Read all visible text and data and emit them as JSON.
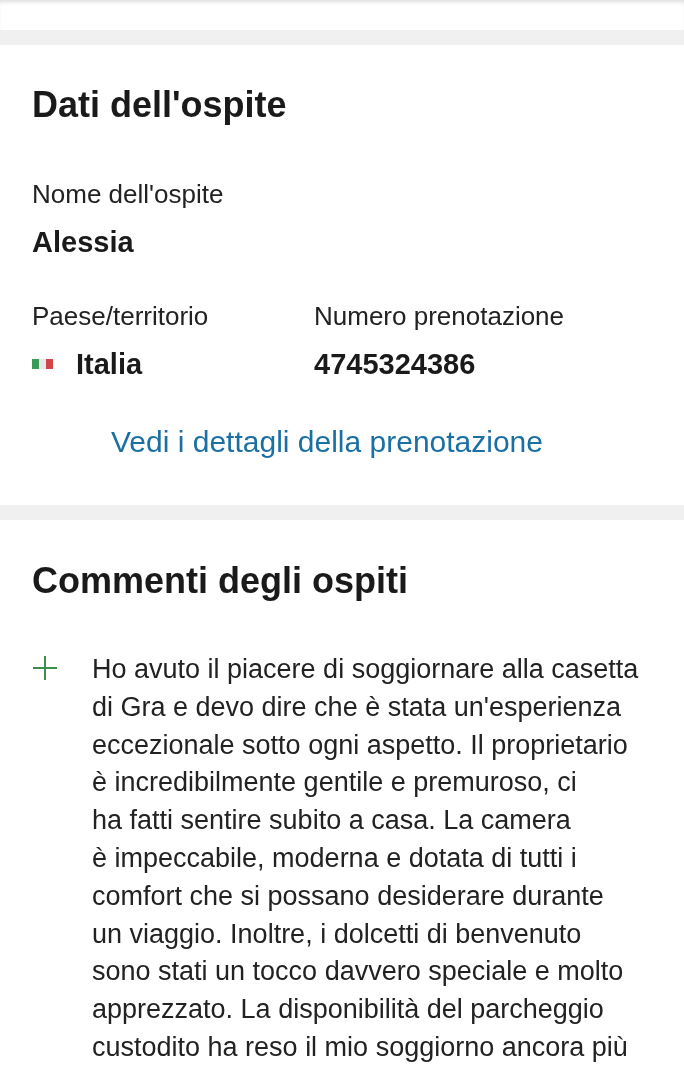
{
  "guest_section": {
    "title": "Dati dell'ospite",
    "name_label": "Nome dell'ospite",
    "name_value": "Alessia",
    "country_label": "Paese/territorio",
    "country_value": "Italia",
    "booking_label": "Numero prenotazione",
    "booking_value": "4745324386",
    "details_link": "Vedi i dettagli della prenotazione"
  },
  "comments_section": {
    "title": "Commenti degli ospiti",
    "comment_lines": [
      "Ho avuto il piacere di soggiornare alla casetta",
      "di Gra e devo dire che è stata un'esperienza",
      "eccezionale sotto ogni aspetto. Il proprietario",
      "è incredibilmente gentile e premuroso, ci",
      "ha fatti  sentire subito a casa. La camera",
      "è impeccabile, moderna e dotata di tutti i",
      "comfort che si possano desiderare durante",
      "un viaggio. Inoltre, i dolcetti di benvenuto",
      "sono stati un tocco davvero speciale e molto",
      "apprezzato. La disponibilità del parcheggio",
      "custodito ha reso il mio soggiorno ancora più"
    ]
  }
}
